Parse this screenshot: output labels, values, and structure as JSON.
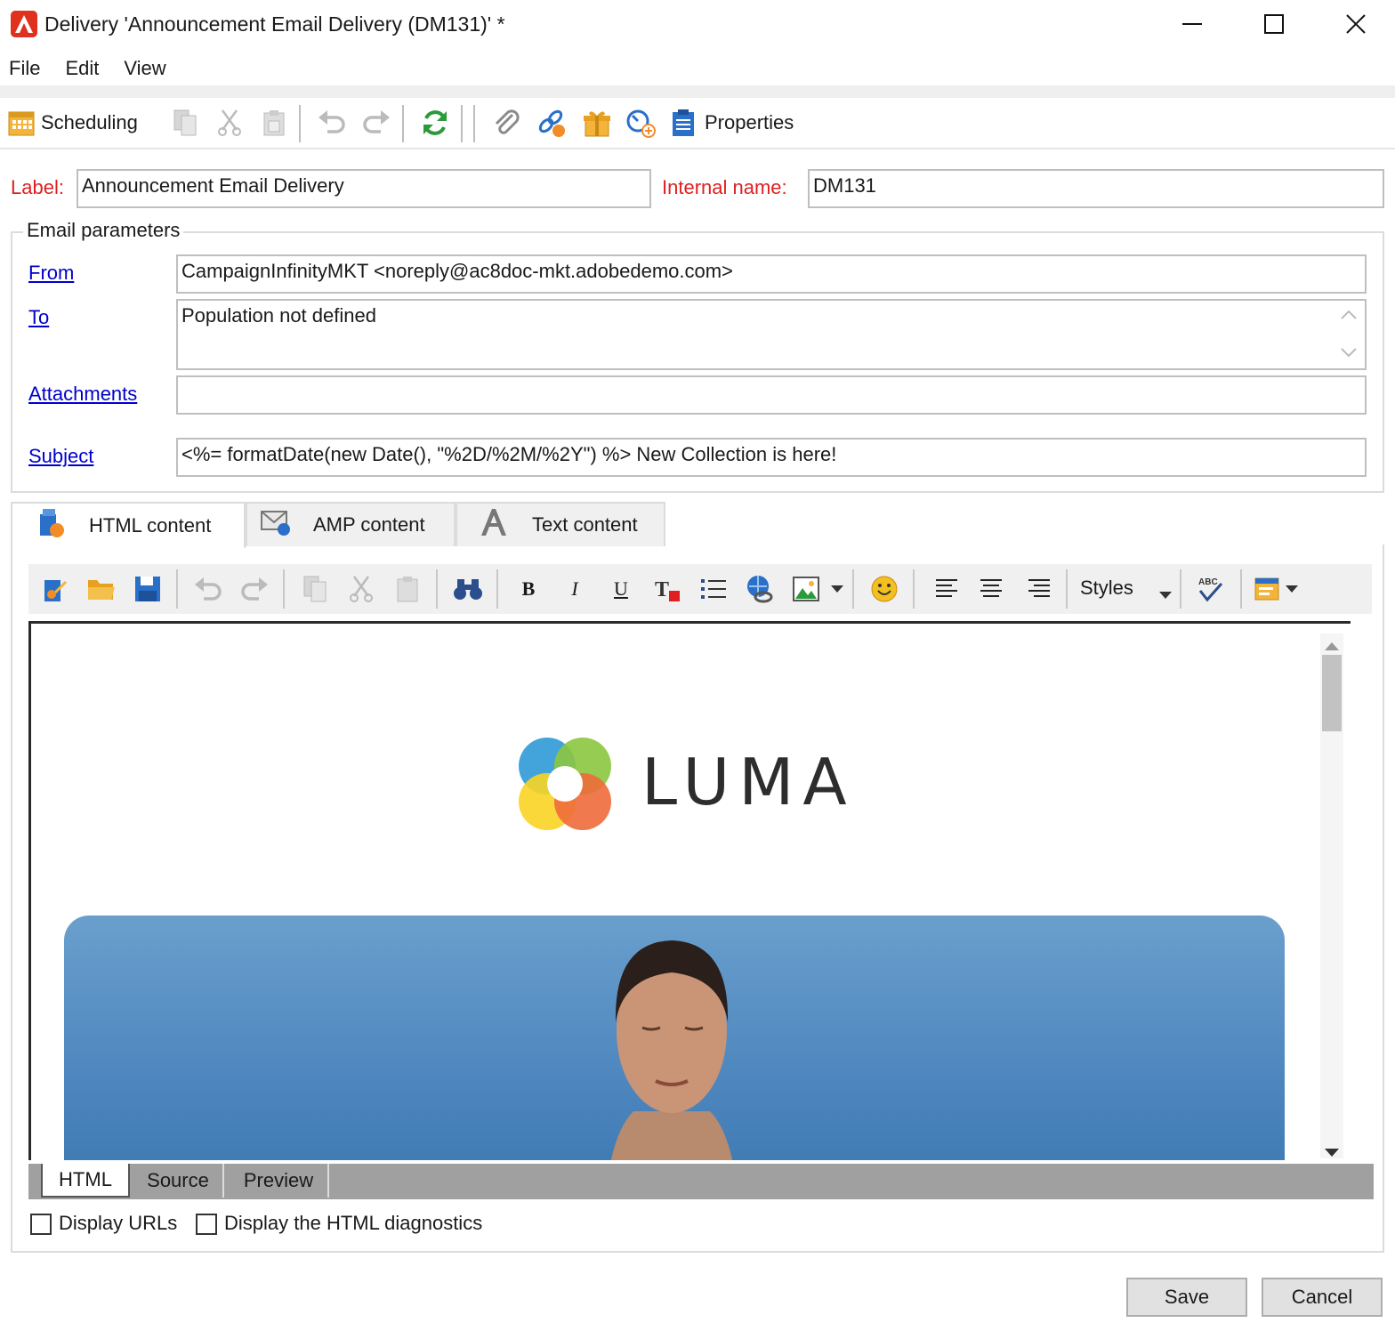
{
  "window": {
    "title": "Delivery 'Announcement Email Delivery (DM131)' *"
  },
  "menu": [
    "File",
    "Edit",
    "View"
  ],
  "toolbar": {
    "scheduling_label": "Scheduling",
    "properties_label": "Properties"
  },
  "form": {
    "label_caption": "Label:",
    "label_value": "Announcement Email Delivery",
    "internal_name_caption": "Internal name:",
    "internal_name_value": "DM131"
  },
  "email_params": {
    "title": "Email parameters",
    "from_link": "From",
    "from_value": "CampaignInfinityMKT <noreply@ac8doc-mkt.adobedemo.com>",
    "to_link": "To",
    "to_value": "Population not defined",
    "attachments_link": "Attachments",
    "attachments_value": "",
    "subject_link": "Subject",
    "subject_value": "<%= formatDate(new Date(), \"%2D/%2M/%2Y\") %> New Collection is here!"
  },
  "content_tabs": [
    {
      "label": "HTML content",
      "icon": "html-content-icon"
    },
    {
      "label": "AMP content",
      "icon": "amp-envelope-icon"
    },
    {
      "label": "Text content",
      "icon": "text-a-icon"
    }
  ],
  "editor_toolbar": {
    "styles_label": "Styles"
  },
  "preview": {
    "brand": "LUMA"
  },
  "bottom_tabs": [
    "HTML",
    "Source",
    "Preview"
  ],
  "options": {
    "display_urls": "Display URLs",
    "display_diagnostics": "Display the HTML diagnostics"
  },
  "buttons": {
    "save": "Save",
    "cancel": "Cancel"
  },
  "colors": {
    "required_label": "#e02020",
    "link": "#0000cc",
    "adobe_red": "#e0301e"
  }
}
